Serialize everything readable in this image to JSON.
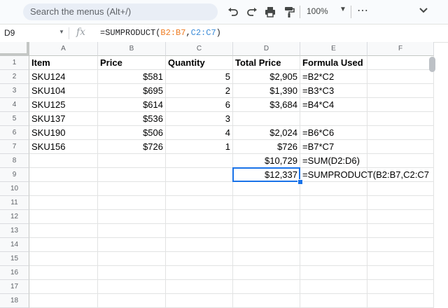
{
  "toolbar": {
    "search_placeholder": "Search the menus (Alt+/)",
    "zoom": "100%"
  },
  "formula_bar": {
    "name_box": "D9",
    "fx_label": "fx",
    "formula_prefix": "=SUMPRODUCT(",
    "formula_ref1": "B2:B7",
    "formula_comma": ",",
    "formula_ref2": "C2:C7",
    "formula_suffix": ")"
  },
  "sheet": {
    "columns": [
      "A",
      "B",
      "C",
      "D",
      "E",
      "F"
    ],
    "rows": [
      "1",
      "2",
      "3",
      "4",
      "5",
      "6",
      "7",
      "8",
      "9",
      "10",
      "11",
      "12",
      "13",
      "14",
      "15",
      "16",
      "17",
      "18"
    ],
    "cells": {
      "A1": "Item",
      "B1": "Price",
      "C1": "Quantity",
      "D1": "Total Price",
      "E1": "Formula Used",
      "A2": "SKU124",
      "B2": "$581",
      "C2": "5",
      "D2": "$2,905",
      "E2": "=B2*C2",
      "A3": "SKU104",
      "B3": "$695",
      "C3": "2",
      "D3": "$1,390",
      "E3": "=B3*C3",
      "A4": "SKU125",
      "B4": "$614",
      "C4": "6",
      "D4": "$3,684",
      "E4": "=B4*C4",
      "A5": "SKU137",
      "B5": "$536",
      "C5": "3",
      "A6": "SKU190",
      "B6": "$506",
      "C6": "4",
      "D6": "$2,024",
      "E6": "=B6*C6",
      "A7": "SKU156",
      "B7": "$726",
      "C7": "1",
      "D7": "$726",
      "E7": "=B7*C7",
      "D8": "$10,729",
      "E8": "=SUM(D2:D6)",
      "D9": "$12,337",
      "E9": "=SUMPRODUCT(B2:B7,C2:C7"
    },
    "selected_cell": "D9"
  },
  "colors": {
    "selection": "#1a73e8",
    "ref_orange": "#ee7c22",
    "ref_blue": "#3a8bd8"
  }
}
